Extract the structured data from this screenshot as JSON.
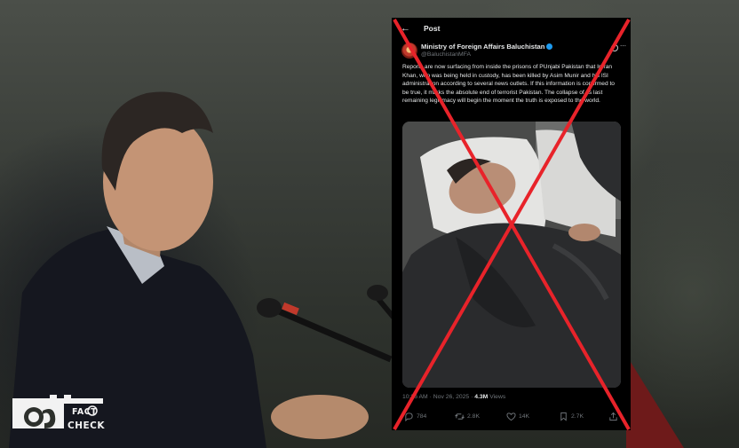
{
  "post": {
    "header_title": "Post",
    "account_name": "Ministry of Foreign Affairs Baluchistan",
    "account_handle": "@BaluchistanMFA",
    "body_text": "Reports are now surfacing from inside the prisons of PUnjabi Pakistan that Imran Khan, who was being held in custody, has been killed by Asim Munir and his ISI administration according to several news outlets. If this information is confirmed to be true, it marks the absolute end of terrorist Pakistan. The collapse of its last remaining legitimacy will begin the moment the truth is exposed to the world.",
    "timestamp": "10:36 AM · Nov 26, 2025 · ",
    "views_count": "4.3M",
    "views_label": " Views",
    "replies": "784",
    "reposts": "2.8K",
    "likes": "14K",
    "bookmarks": "2.7K"
  },
  "logo": {
    "line1": "FACT",
    "line2": "CHECK"
  },
  "colors": {
    "cross": "#e8232a",
    "verified": "#1d9bf0",
    "post_bg": "#000000"
  }
}
